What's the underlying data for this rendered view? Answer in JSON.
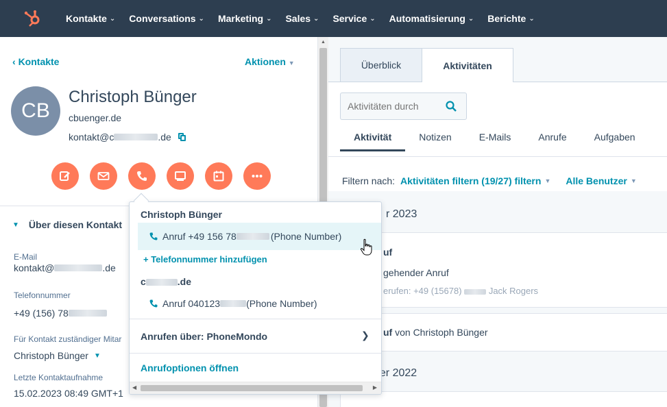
{
  "nav": {
    "items": [
      {
        "label": "Kontakte"
      },
      {
        "label": "Conversations"
      },
      {
        "label": "Marketing"
      },
      {
        "label": "Sales"
      },
      {
        "label": "Service"
      },
      {
        "label": "Automatisierung"
      },
      {
        "label": "Berichte"
      }
    ]
  },
  "contact": {
    "back_label": "Kontakte",
    "actions_label": "Aktionen",
    "initials": "CB",
    "name": "Christoph Bünger",
    "company": "cbuenger.de",
    "email_prefix": "kontakt@c",
    "email_suffix": ".de"
  },
  "about": {
    "title": "Über diesen Kontakt",
    "email_label": "E-Mail",
    "email_prefix": "kontakt@",
    "email_suffix": ".de",
    "phone_label": "Telefonnummer",
    "phone_prefix": "+49 (156) 78",
    "owner_label": "Für Kontakt zuständiger Mitar",
    "owner_value": "Christoph Bünger",
    "last_contact_label": "Letzte Kontaktaufnahme",
    "last_contact_value": "15.02.2023 08:49 GMT+1"
  },
  "right": {
    "tab_overview": "Überblick",
    "tab_activities": "Aktivitäten",
    "search_placeholder": "Aktivitäten durch",
    "subtabs": [
      "Aktivität",
      "Notizen",
      "E-Mails",
      "Anrufe",
      "Aufgaben"
    ],
    "filter_label": "Filtern nach:",
    "filter_activities": "Aktivitäten filtern (19/27) filtern",
    "filter_users": "Alle Benutzer",
    "month1": "r 2023",
    "card1_title": "uf",
    "card1_text": "gehender Anruf",
    "card1_faint": "erufen: +49 (15678)",
    "card1_faint_name": "Jack Rogers",
    "card2_title": "uf",
    "card2_text": " von Christoph Bünger",
    "month2": "ber 2022"
  },
  "dropdown": {
    "section1": "Christoph Bünger",
    "call1_prefix": "Anruf +49 156 78",
    "call1_suffix": "(Phone Number)",
    "add_phone": "+ Telefonnummer hinzufügen",
    "section2_prefix": "c",
    "section2_suffix": ".de",
    "call2_prefix": "Anruf 040123",
    "call2_suffix": " (Phone Number)",
    "call_via": "Anrufen über: PhoneMondo",
    "open_options": "Anrufoptionen öffnen"
  }
}
